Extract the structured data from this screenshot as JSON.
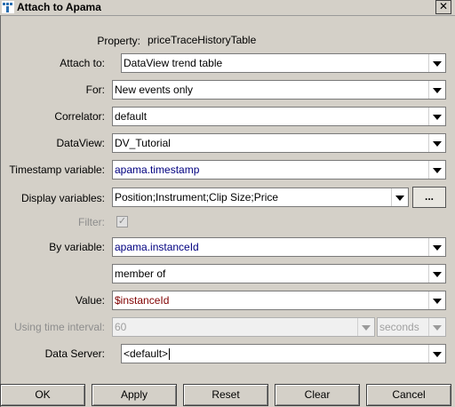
{
  "window": {
    "title": "Attach to Apama",
    "close_glyph": "✕"
  },
  "fields": {
    "property_label": "Property:",
    "property_value": "priceTraceHistoryTable",
    "attach_to_label": "Attach to:",
    "attach_to_value": "DataView trend table",
    "for_label": "For:",
    "for_value": "New events only",
    "correlator_label": "Correlator:",
    "correlator_value": "default",
    "dataview_label": "DataView:",
    "dataview_value": "DV_Tutorial",
    "timestamp_label": "Timestamp variable:",
    "timestamp_value": "apama.timestamp",
    "display_vars_label": "Display variables:",
    "display_vars_value": "Position;Instrument;Clip Size;Price",
    "display_vars_button": "...",
    "filter_label": "Filter:",
    "filter_checked": true,
    "by_variable_label": "By variable:",
    "by_variable_value": "apama.instanceId",
    "operator_value": "member of",
    "value_label": "Value:",
    "value_value": "$instanceId",
    "time_interval_label": "Using time interval:",
    "time_interval_value": "60",
    "time_unit_value": "seconds",
    "data_server_label": "Data Server:",
    "data_server_value": "<default>"
  },
  "buttons": {
    "ok": "OK",
    "apply": "Apply",
    "reset": "Reset",
    "clear": "Clear",
    "cancel": "Cancel"
  },
  "colors": {
    "variable_text": "#000080",
    "value_text": "#800000",
    "disabled_text": "#8d8d8d"
  }
}
